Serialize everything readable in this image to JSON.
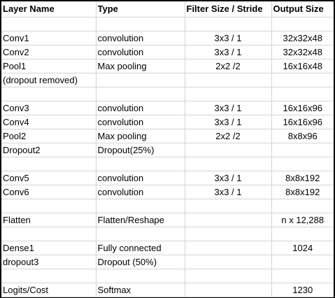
{
  "table": {
    "headers": [
      "Layer Name",
      "Type",
      "Filter Size / Stride",
      "Output Size"
    ],
    "rows": [
      [
        "",
        "",
        "",
        ""
      ],
      [
        "Conv1",
        "convolution",
        "3x3 / 1",
        "32x32x48"
      ],
      [
        "Conv2",
        "convolution",
        "3x3 / 1",
        "32x32x48"
      ],
      [
        "Pool1",
        "Max pooling",
        "2x2 /2",
        "16x16x48"
      ],
      [
        "(dropout removed)",
        "",
        "",
        ""
      ],
      [
        "",
        "",
        "",
        ""
      ],
      [
        "Conv3",
        "convolution",
        "3x3 / 1",
        "16x16x96"
      ],
      [
        "Conv4",
        "convolution",
        "3x3 / 1",
        "16x16x96"
      ],
      [
        "Pool2",
        "Max pooling",
        "2x2 /2",
        "8x8x96"
      ],
      [
        "Dropout2",
        "Dropout(25%)",
        "",
        ""
      ],
      [
        "",
        "",
        "",
        ""
      ],
      [
        "Conv5",
        "convolution",
        "3x3 / 1",
        "8x8x192"
      ],
      [
        "Conv6",
        "convolution",
        "3x3 / 1",
        "8x8x192"
      ],
      [
        "",
        "",
        "",
        ""
      ],
      [
        "Flatten",
        "Flatten/Reshape",
        "",
        "n x 12,288"
      ],
      [
        "",
        "",
        "",
        ""
      ],
      [
        "Dense1",
        "Fully connected",
        "",
        "1024"
      ],
      [
        "dropout3",
        "Dropout (50%)",
        "",
        ""
      ],
      [
        "",
        "",
        "",
        ""
      ],
      [
        "Logits/Cost",
        "Softmax",
        "",
        "1230"
      ]
    ]
  }
}
